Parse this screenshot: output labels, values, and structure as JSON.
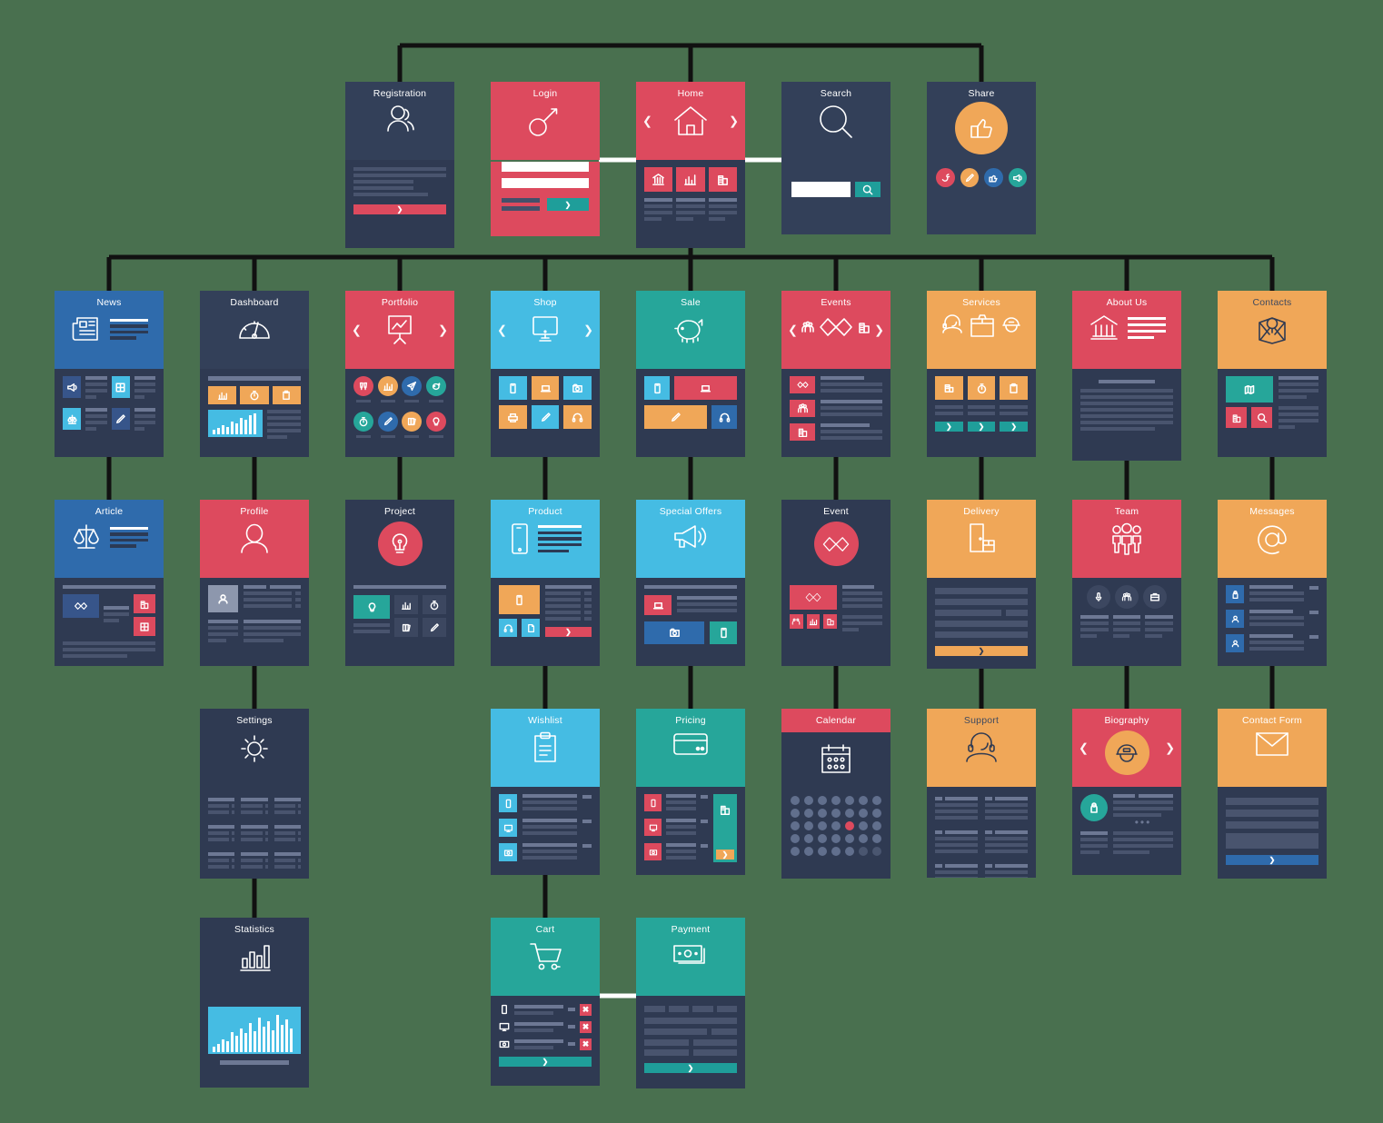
{
  "diagram": {
    "title": "Website Sitemap / Flowchart",
    "background_color": "#49704f",
    "connector_color": "#111111",
    "inline_connector_color": "#ffffff",
    "palette": {
      "dark_navy": "#2f3a52",
      "dark_navy_header": "#334059",
      "red": "#dd4a5e",
      "blue": "#2f6bac",
      "light_blue": "#45bce3",
      "teal": "#26a69a",
      "orange": "#f0a758",
      "bar_dark": "#49546e",
      "bar_light": "#6d7894"
    }
  },
  "rows": [
    {
      "name": "row-1",
      "cards": [
        {
          "id": "registration",
          "label": "Registration",
          "header_color": "#334059",
          "title_color": "#ffffff",
          "icon": "users-icon",
          "arrows": false
        },
        {
          "id": "login",
          "label": "Login",
          "header_color": "#dd4a5e",
          "title_color": "#ffffff",
          "icon": "key-icon",
          "arrows": false
        },
        {
          "id": "home",
          "label": "Home",
          "header_color": "#dd4a5e",
          "title_color": "#ffffff",
          "icon": "house-icon",
          "arrows": true
        },
        {
          "id": "search",
          "label": "Search",
          "header_color": "#334059",
          "title_color": "#ffffff",
          "icon": "magnifier-icon",
          "arrows": false
        },
        {
          "id": "share",
          "label": "Share",
          "header_color": "#334059",
          "title_color": "#ffffff",
          "icon": "thumbs-up-icon",
          "arrows": false
        }
      ]
    },
    {
      "name": "row-2",
      "cards": [
        {
          "id": "news",
          "label": "News",
          "header_color": "#2f6bac",
          "title_color": "#ffffff",
          "icon": "newspaper-icon",
          "arrows": false
        },
        {
          "id": "dashboard",
          "label": "Dashboard",
          "header_color": "#334059",
          "title_color": "#ffffff",
          "icon": "gauge-icon",
          "arrows": false
        },
        {
          "id": "portfolio",
          "label": "Portfolio",
          "header_color": "#dd4a5e",
          "title_color": "#ffffff",
          "icon": "chart-board-icon",
          "arrows": true
        },
        {
          "id": "shop",
          "label": "Shop",
          "header_color": "#45bce3",
          "title_color": "#ffffff",
          "icon": "monitor-icon",
          "arrows": true
        },
        {
          "id": "sale",
          "label": "Sale",
          "header_color": "#26a69a",
          "title_color": "#ffffff",
          "icon": "piggy-bank-icon",
          "arrows": false
        },
        {
          "id": "events",
          "label": "Events",
          "header_color": "#dd4a5e",
          "title_color": "#ffffff",
          "icon": "handshake-icon",
          "arrows": true
        },
        {
          "id": "services",
          "label": "Services",
          "header_color": "#f0a758",
          "title_color": "#ffffff",
          "icon": "support-box-icon",
          "arrows": false
        },
        {
          "id": "aboutus",
          "label": "About Us",
          "header_color": "#dd4a5e",
          "title_color": "#ffffff",
          "icon": "bank-icon",
          "arrows": false
        },
        {
          "id": "contacts",
          "label": "Contacts",
          "header_color": "#f0a758",
          "title_color": "#3f4a5f",
          "icon": "map-pin-icon",
          "arrows": false
        }
      ]
    },
    {
      "name": "row-3",
      "cards": [
        {
          "id": "article",
          "label": "Article",
          "header_color": "#2f6bac",
          "title_color": "#ffffff",
          "icon": "scales-icon",
          "arrows": false
        },
        {
          "id": "profile",
          "label": "Profile",
          "header_color": "#dd4a5e",
          "title_color": "#ffffff",
          "icon": "person-icon",
          "arrows": false
        },
        {
          "id": "project",
          "label": "Project",
          "header_color": "#334059",
          "title_color": "#ffffff",
          "icon": "lightbulb-icon",
          "arrows": false
        },
        {
          "id": "product",
          "label": "Product",
          "header_color": "#45bce3",
          "title_color": "#ffffff",
          "icon": "phone-icon",
          "arrows": false
        },
        {
          "id": "specialoffers",
          "label": "Special Offers",
          "header_color": "#45bce3",
          "title_color": "#ffffff",
          "icon": "megaphone-icon",
          "arrows": false
        },
        {
          "id": "event",
          "label": "Event",
          "header_color": "#334059",
          "title_color": "#ffffff",
          "icon": "handshake-icon",
          "arrows": false
        },
        {
          "id": "delivery",
          "label": "Delivery",
          "header_color": "#f0a758",
          "title_color": "#ffffff",
          "icon": "door-package-icon",
          "arrows": false
        },
        {
          "id": "team",
          "label": "Team",
          "header_color": "#dd4a5e",
          "title_color": "#ffffff",
          "icon": "group-icon",
          "arrows": false
        },
        {
          "id": "messages",
          "label": "Messages",
          "header_color": "#f0a758",
          "title_color": "#ffffff",
          "icon": "at-sign-icon",
          "arrows": false
        }
      ]
    },
    {
      "name": "row-4",
      "cards": [
        {
          "id": "settings",
          "label": "Settings",
          "header_color": "#334059",
          "title_color": "#ffffff",
          "icon": "gear-icon",
          "arrows": false
        },
        {
          "id": "wishlist",
          "label": "Wishlist",
          "header_color": "#45bce3",
          "title_color": "#ffffff",
          "icon": "clipboard-icon",
          "arrows": false
        },
        {
          "id": "pricing",
          "label": "Pricing",
          "header_color": "#26a69a",
          "title_color": "#ffffff",
          "icon": "credit-card-icon",
          "arrows": false
        },
        {
          "id": "calendar",
          "label": "Calendar",
          "header_color": "#dd4a5e",
          "title_color": "#ffffff",
          "icon": "calendar-icon",
          "arrows": false
        },
        {
          "id": "support",
          "label": "Support",
          "header_color": "#f0a758",
          "title_color": "#3f4a5f",
          "icon": "headset-person-icon",
          "arrows": false
        },
        {
          "id": "biography",
          "label": "Biography",
          "header_color": "#dd4a5e",
          "title_color": "#ffffff",
          "icon": "helmet-person-icon",
          "arrows": true
        },
        {
          "id": "contactform",
          "label": "Contact Form",
          "header_color": "#f0a758",
          "title_color": "#ffffff",
          "icon": "envelope-icon",
          "arrows": false
        }
      ]
    },
    {
      "name": "row-5",
      "cards": [
        {
          "id": "statistics",
          "label": "Statistics",
          "header_color": "#334059",
          "title_color": "#ffffff",
          "icon": "bar-chart-icon",
          "arrows": false
        },
        {
          "id": "cart",
          "label": "Cart",
          "header_color": "#26a69a",
          "title_color": "#ffffff",
          "icon": "shopping-cart-icon",
          "arrows": false
        },
        {
          "id": "payment",
          "label": "Payment",
          "header_color": "#26a69a",
          "title_color": "#ffffff",
          "icon": "banknote-icon",
          "arrows": false
        }
      ]
    }
  ],
  "share_reactions": [
    "clap-icon",
    "pen-icon",
    "thumbs-up-icon",
    "megaphone-icon"
  ],
  "search": {
    "input_value": "",
    "button_icon": "magnifier-icon"
  },
  "login": {
    "field_1": "",
    "field_2": "",
    "submit_icon": "chevron-right-icon"
  }
}
